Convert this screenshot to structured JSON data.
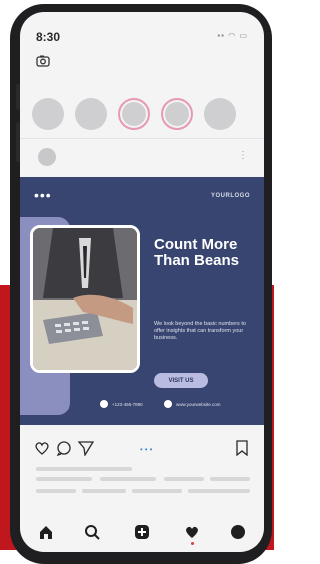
{
  "status_bar": {
    "time": "8:30",
    "signal_icons": "▪▪ ◠ ▭"
  },
  "stories": [
    {
      "ring": false
    },
    {
      "ring": false
    },
    {
      "ring": true
    },
    {
      "ring": true
    },
    {
      "ring": false
    }
  ],
  "post_header": {
    "more": "⋮"
  },
  "post": {
    "brand_logo": "YOURLOGO",
    "headline": "Count More Than Beans",
    "body": "We look beyond the basic numbers to offer insights that can transform your business.",
    "cta_label": "VISIT US",
    "phone": "+123-456-7890",
    "website": "www.yourwebsite.com"
  },
  "carousel_indicator": "•••",
  "colors": {
    "post_bg": "#374570",
    "accent_red": "#c0161e",
    "button_bg": "#b9bce0"
  }
}
